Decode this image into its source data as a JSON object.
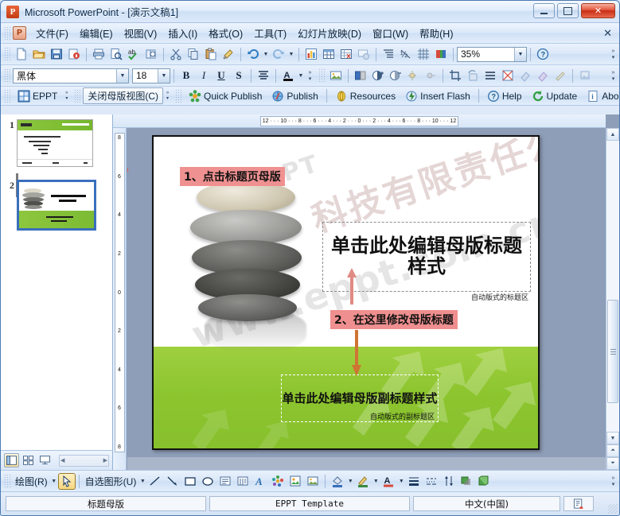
{
  "window": {
    "title": "Microsoft PowerPoint - [演示文稿1]",
    "app_icon": "powerpoint-icon",
    "minimize_label": "",
    "maximize_label": "",
    "close_label": "✕"
  },
  "menubar": {
    "doc_icon": "document-icon",
    "close_doc_label": "✕",
    "items": [
      {
        "label": "文件(F)"
      },
      {
        "label": "编辑(E)"
      },
      {
        "label": "视图(V)"
      },
      {
        "label": "插入(I)"
      },
      {
        "label": "格式(O)"
      },
      {
        "label": "工具(T)"
      },
      {
        "label": "幻灯片放映(D)"
      },
      {
        "label": "窗口(W)"
      },
      {
        "label": "帮助(H)"
      }
    ]
  },
  "standard_toolbar": {
    "buttons": [
      {
        "name": "new-file-icon",
        "glyph": "🗋"
      },
      {
        "name": "open-folder-icon",
        "glyph": "📂"
      },
      {
        "name": "save-icon",
        "glyph": "💾"
      },
      {
        "name": "permission-icon",
        "glyph": "🔒"
      },
      {
        "name": "print-icon",
        "glyph": "🖶"
      },
      {
        "name": "print-preview-icon",
        "glyph": "🔍"
      },
      {
        "name": "spellcheck-icon",
        "glyph": "ab"
      },
      {
        "name": "research-icon",
        "glyph": "📖"
      },
      {
        "name": "cut-icon",
        "glyph": "✂"
      },
      {
        "name": "copy-icon",
        "glyph": "⧉"
      },
      {
        "name": "paste-icon",
        "glyph": "📋"
      },
      {
        "name": "format-painter-icon",
        "glyph": "🖌"
      },
      {
        "name": "undo-icon",
        "glyph": "↶"
      },
      {
        "name": "redo-icon",
        "glyph": "↷"
      },
      {
        "name": "insert-chart-icon",
        "glyph": "📊"
      },
      {
        "name": "insert-table-icon",
        "glyph": "▦"
      },
      {
        "name": "insert-table-excel-icon",
        "glyph": "🗒"
      },
      {
        "name": "new-slide-icon",
        "glyph": "🖼"
      },
      {
        "name": "expand-all-icon",
        "glyph": "≣"
      },
      {
        "name": "show-formatting-icon",
        "glyph": "½"
      },
      {
        "name": "grid-icon",
        "glyph": "▦"
      },
      {
        "name": "color-scheme-icon",
        "glyph": "▮"
      }
    ],
    "zoom_value": "35%",
    "help_icon": "help-icon"
  },
  "formatting_toolbar": {
    "font_name": "黑体",
    "font_size": "18",
    "bold_label": "B",
    "italic_label": "I",
    "underline_label": "U",
    "shadow_label": "S",
    "align_icon": "align-center-icon",
    "font_color_label": "A"
  },
  "picture_toolbar": {
    "buttons": [
      {
        "name": "insert-picture-icon",
        "glyph": "🖼"
      },
      {
        "name": "color-mode-icon",
        "glyph": "◧"
      },
      {
        "name": "more-contrast-icon",
        "glyph": "◑"
      },
      {
        "name": "less-contrast-icon",
        "glyph": "◐"
      },
      {
        "name": "more-brightness-icon",
        "glyph": "☀"
      },
      {
        "name": "less-brightness-icon",
        "glyph": "☼"
      },
      {
        "name": "crop-icon",
        "glyph": "⌗"
      },
      {
        "name": "rotate-left-icon",
        "glyph": "⟲"
      },
      {
        "name": "line-style-icon",
        "glyph": "≡"
      },
      {
        "name": "compress-picture-icon",
        "glyph": "⛶"
      },
      {
        "name": "recolor-picture-icon",
        "glyph": "◇"
      },
      {
        "name": "format-picture-icon",
        "glyph": "◈"
      },
      {
        "name": "set-transparent-color-icon",
        "glyph": "✎"
      },
      {
        "name": "reset-picture-icon",
        "glyph": "↺"
      }
    ]
  },
  "eppt_toolbar": {
    "eppt_label": "EPPT",
    "eppt_icon": "eppt-grid-icon",
    "close_master_label": "关闭母版视图(C)",
    "items": [
      {
        "label": "Quick Publish",
        "icon": "quick-publish-icon"
      },
      {
        "label": "Publish",
        "icon": "publish-icon"
      },
      {
        "label": "Resources",
        "icon": "resources-icon"
      },
      {
        "label": "Insert Flash",
        "icon": "insert-flash-icon"
      },
      {
        "label": "Help",
        "icon": "help-icon"
      },
      {
        "label": "Update",
        "icon": "update-icon"
      },
      {
        "label": "About",
        "icon": "about-icon"
      }
    ]
  },
  "thumbnails": {
    "slides": [
      {
        "number": "1",
        "selected": false
      },
      {
        "number": "2",
        "selected": true
      }
    ]
  },
  "view_bar": {
    "buttons": [
      {
        "name": "normal-view-button",
        "glyph": "▤",
        "active": true
      },
      {
        "name": "slide-sorter-button",
        "glyph": "⊞",
        "active": false
      },
      {
        "name": "slideshow-button",
        "glyph": "🖵",
        "active": false
      }
    ]
  },
  "rulers": {
    "horizontal_ticks": "12 · · · 10 · · · 8 · · · 6 · · · 4 · · · 2 · · · 0 · · · 2 · · · 4 · · · 6 · · · 8 · · · 10 · · · 12",
    "vertical_ticks": [
      "8",
      "6",
      "4",
      "2",
      "0",
      "2",
      "4",
      "6",
      "8"
    ]
  },
  "slide": {
    "title_placeholder": "单击此处编辑母版标题样式",
    "title_hint": "自动版式的标题区",
    "subtitle_placeholder": "单击此处编辑母版副标题样式",
    "subtitle_hint": "自动版式的副标题区",
    "watermark_eppt": "EPPT",
    "watermark_company": "科技有限责任公司",
    "watermark_url": "www.eppt.com.cn",
    "annotations": [
      {
        "label": "1、点击标题页母版",
        "color": "#f09191"
      },
      {
        "label": "2、在这里修改母版标题",
        "color": "#ef8f8f"
      }
    ],
    "colors": {
      "green": "#8dc52f",
      "annotation_pink": "#f09191",
      "arrow_red": "#d9625a",
      "arrow_orange": "#d4753c"
    }
  },
  "drawing_toolbar": {
    "draw_label": "绘图(R)",
    "autoshapes_label": "自选图形(U)",
    "buttons": [
      {
        "name": "select-objects-icon",
        "glyph": "↖"
      },
      {
        "name": "line-icon",
        "glyph": "╲"
      },
      {
        "name": "arrow-icon",
        "glyph": "↘"
      },
      {
        "name": "rectangle-icon",
        "glyph": "▭"
      },
      {
        "name": "oval-icon",
        "glyph": "◯"
      },
      {
        "name": "text-box-icon",
        "glyph": "▤"
      },
      {
        "name": "vertical-text-box-icon",
        "glyph": "▥"
      },
      {
        "name": "insert-wordart-icon",
        "glyph": "A"
      },
      {
        "name": "insert-diagram-icon",
        "glyph": "❀"
      },
      {
        "name": "insert-clipart-icon",
        "glyph": "▨"
      },
      {
        "name": "insert-picture-icon",
        "glyph": "▧"
      },
      {
        "name": "fill-color-icon",
        "glyph": "🪣"
      },
      {
        "name": "line-color-icon",
        "glyph": "🖊"
      },
      {
        "name": "font-color-icon",
        "glyph": "A"
      },
      {
        "name": "line-style-icon",
        "glyph": "≡"
      },
      {
        "name": "dash-style-icon",
        "glyph": "┅"
      },
      {
        "name": "arrow-style-icon",
        "glyph": "⇵"
      },
      {
        "name": "shadow-style-icon",
        "glyph": "▮"
      },
      {
        "name": "3d-style-icon",
        "glyph": "▯"
      }
    ]
  },
  "statusbar": {
    "cells": [
      {
        "name": "slide-layout-status",
        "text": "标题母版"
      },
      {
        "name": "design-template-status",
        "text": "EPPT Template"
      },
      {
        "name": "language-status",
        "text": "中文(中国)"
      }
    ],
    "spellcheck_icon": "spellcheck-status-icon"
  }
}
